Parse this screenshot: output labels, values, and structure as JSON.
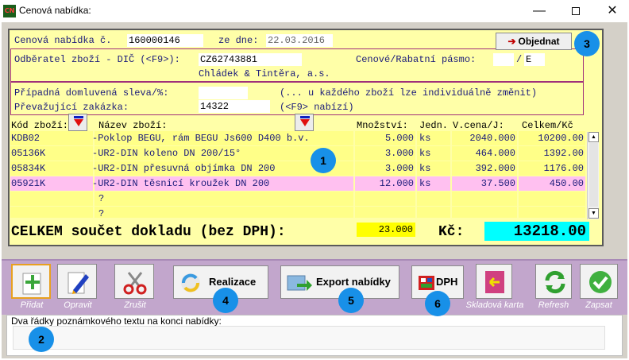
{
  "window": {
    "title": "Cenová nabídka:",
    "app_icon": "CN",
    "minimize": "—",
    "close": "✕"
  },
  "header": {
    "offer_label": "Cenová nabídka č.",
    "offer_number": "160000146",
    "date_label": "ze dne:",
    "date": "22.03.2016",
    "order_button": "Objednat",
    "customer_label": "Odběratel zboží - DIČ (<F9>):",
    "customer_dic": "CZ62743881",
    "customer_name": "Chládek & Tintěra, a.s.",
    "price_band_label": "Cenové/Rabatní pásmo:",
    "price_band_value": "",
    "price_band_sep": "/",
    "rabate_band_value": "E",
    "discount_label": "Případná domluvená sleva/%:",
    "discount_value": "",
    "discount_note": "(... u každého zboží lze individuálně změnit)",
    "contract_label": "Převažující zakázka:",
    "contract_value": "14322",
    "contract_note": "(<F9> nabízí)"
  },
  "table": {
    "columns": {
      "code": "Kód zboží:",
      "name": "Název zboží:",
      "qty": "Množství:",
      "unit": "Jedn.",
      "unit_price": "V.cena/J:",
      "total": "Celkem/Kč"
    },
    "rows": [
      {
        "code": "KDB02",
        "name": "-Poklop BEGU, rám BEGU Js600 D400 b.v.",
        "qty": "5.000",
        "unit": "ks",
        "unit_price": "2040.000",
        "total": "10200.00"
      },
      {
        "code": "05136K",
        "name": "-UR2-DIN koleno DN 200/15°",
        "qty": "3.000",
        "unit": "ks",
        "unit_price": "464.000",
        "total": "1392.00"
      },
      {
        "code": "05834K",
        "name": "-UR2-DIN přesuvná objímka DN 200",
        "qty": "3.000",
        "unit": "ks",
        "unit_price": "392.000",
        "total": "1176.00"
      },
      {
        "code": "05921K",
        "name": "-UR2-DIN těsnicí kroužek DN 200",
        "qty": "12.000",
        "unit": "ks",
        "unit_price": "37.500",
        "total": "450.00"
      },
      {
        "code": "",
        "name": "?",
        "qty": "",
        "unit": "",
        "unit_price": "",
        "total": ""
      },
      {
        "code": "",
        "name": "?",
        "qty": "",
        "unit": "",
        "unit_price": "",
        "total": ""
      }
    ],
    "total_label": "CELKEM součet dokladu (bez DPH):",
    "total_qty": "23.000",
    "currency_label": "Kč:",
    "grand_total": "13218.00"
  },
  "toolbar": {
    "add": "Přidat",
    "edit": "Opravit",
    "cancel": "Zrušit",
    "realize": "Realizace",
    "export": "Export nabídky",
    "vat": "DPH",
    "stock_card": "Skladová karta",
    "refresh": "Refresh",
    "save": "Zapsat"
  },
  "notes": {
    "label": "Dva řádky poznámkového textu na konci nabídky:",
    "value": ""
  },
  "badges": {
    "b1": "1",
    "b2": "2",
    "b3": "3",
    "b4": "4",
    "b5": "5",
    "b6": "6"
  },
  "colors": {
    "panel": "#ffffa8",
    "row": "#ffff88",
    "selected_row": "#ffc0f0",
    "total": "#00ffff",
    "toolbar": "#c2a6cc",
    "badge": "#1890e8"
  }
}
